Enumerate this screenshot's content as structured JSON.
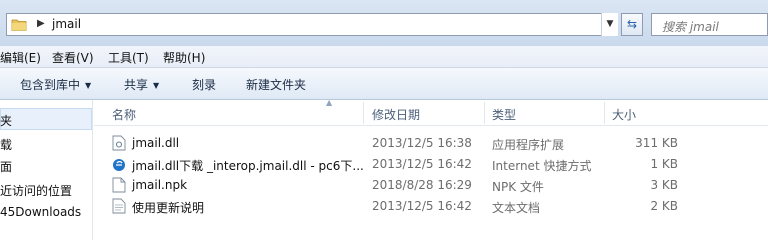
{
  "address": {
    "path": "jmail",
    "search_placeholder": "搜索 jmail"
  },
  "menu": [
    {
      "id": "edit",
      "label": "编辑(E)"
    },
    {
      "id": "view",
      "label": "查看(V)"
    },
    {
      "id": "tools",
      "label": "工具(T)"
    },
    {
      "id": "help",
      "label": "帮助(H)"
    }
  ],
  "toolbar": {
    "include_library": "包含到库中",
    "share": "共享",
    "burn": "刻录",
    "new_folder": "新建文件夹"
  },
  "nav": {
    "items": [
      "夹",
      "载",
      "面",
      "近访问的位置",
      "45Downloads"
    ]
  },
  "columns": {
    "name": "名称",
    "date": "修改日期",
    "type": "类型",
    "size": "大小"
  },
  "files": [
    {
      "name": "jmail.dll",
      "date": "2013/12/5 16:38",
      "type": "应用程序扩展",
      "size": "311 KB",
      "icon": "dll-file-icon"
    },
    {
      "name": "jmail.dll下载 _interop.jmail.dll - pc6下...",
      "date": "2013/12/5 16:42",
      "type": "Internet 快捷方式",
      "size": "1 KB",
      "icon": "internet-shortcut-icon"
    },
    {
      "name": "jmail.npk",
      "date": "2018/8/28 16:29",
      "type": "NPK 文件",
      "size": "3 KB",
      "icon": "file-icon"
    },
    {
      "name": "使用更新说明",
      "date": "2013/12/5 16:42",
      "type": "文本文档",
      "size": "2 KB",
      "icon": "text-file-icon"
    }
  ],
  "colors": {
    "chrome_gradient_top": "#dbe6f3",
    "selection": "#e8f1fb",
    "muted_text": "#6d6d6d"
  }
}
